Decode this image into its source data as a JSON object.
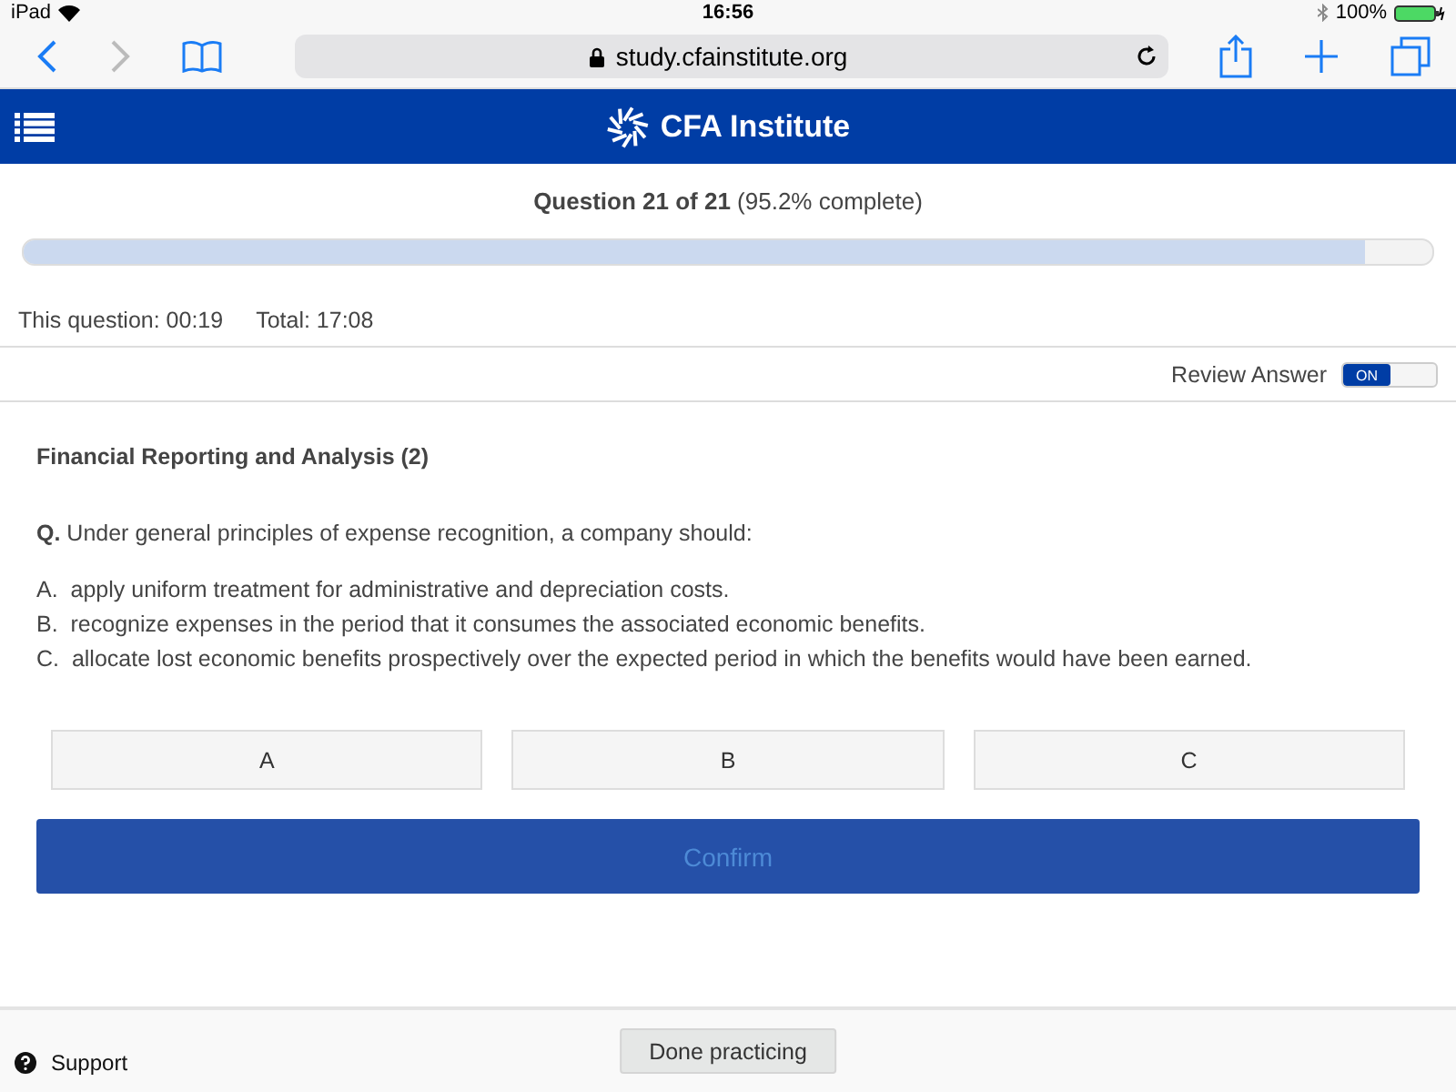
{
  "status_bar": {
    "device": "iPad",
    "time": "16:56",
    "battery": "100%"
  },
  "browser": {
    "url": "study.cfainstitute.org"
  },
  "header": {
    "brand": "CFA Institute"
  },
  "progress": {
    "title": "Question 21 of 21",
    "detail": "(95.2% complete)",
    "level": 0.952
  },
  "timer": {
    "question": "This question: 00:19",
    "total": "Total: 17:08"
  },
  "review": {
    "label": "Review Answer",
    "state": "ON",
    "on": true
  },
  "topic": "Financial Reporting and Analysis (2)",
  "question": "**Q.** Under general principles of expense recognition, a company should:",
  "options": [
    {
      "letter": "A.",
      "text": "apply uniform treatment for administrative and depreciation costs."
    },
    {
      "letter": "B.",
      "text": "recognize expenses in the period that it consumes the associated economic benefits."
    },
    {
      "letter": "C.",
      "text": "allocate lost economic benefits prospectively over the expected period in which the benefits would have been earned."
    }
  ],
  "answers": [
    {
      "label": "A",
      "selected": false
    },
    {
      "label": "B",
      "selected": false
    },
    {
      "label": "C",
      "selected": false
    }
  ],
  "confirm": {
    "label": "Confirm",
    "disabled": true
  },
  "footer": {
    "support": "Support",
    "done": "Done practicing"
  }
}
